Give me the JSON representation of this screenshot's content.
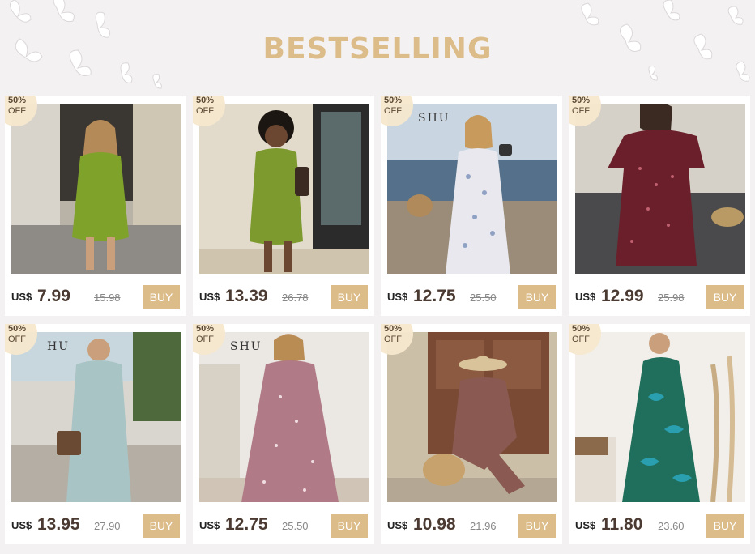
{
  "heading": "BESTSELLING",
  "colors": {
    "accent": "#dcbc88",
    "background": "#f3f1f2",
    "card": "#ffffff",
    "badge": "#f6e8ce"
  },
  "products": [
    {
      "discount_pct": "50%",
      "discount_off": "OFF",
      "currency": "US$",
      "price": "7.99",
      "old_price": "15.98",
      "buy_label": "BUY",
      "image": "green-ruched-mini-dress-photo",
      "overlay_text": ""
    },
    {
      "discount_pct": "50%",
      "discount_off": "OFF",
      "currency": "US$",
      "price": "13.39",
      "old_price": "26.78",
      "buy_label": "BUY",
      "image": "green-button-mini-dress-photo",
      "overlay_text": ""
    },
    {
      "discount_pct": "50%",
      "discount_off": "OFF",
      "currency": "US$",
      "price": "12.75",
      "old_price": "25.50",
      "buy_label": "BUY",
      "image": "white-floral-midi-dress-photo",
      "overlay_text": "SHU"
    },
    {
      "discount_pct": "50%",
      "discount_off": "OFF",
      "currency": "US$",
      "price": "12.99",
      "old_price": "25.98",
      "buy_label": "BUY",
      "image": "burgundy-puff-sleeve-dress-photo",
      "overlay_text": ""
    },
    {
      "discount_pct": "50%",
      "discount_off": "OFF",
      "currency": "US$",
      "price": "13.95",
      "old_price": "27.90",
      "buy_label": "BUY",
      "image": "light-blue-shirt-dress-photo",
      "overlay_text": "HU"
    },
    {
      "discount_pct": "50%",
      "discount_off": "OFF",
      "currency": "US$",
      "price": "12.75",
      "old_price": "25.50",
      "buy_label": "BUY",
      "image": "pink-floral-maxi-dress-photo",
      "overlay_text": "SHU"
    },
    {
      "discount_pct": "50%",
      "discount_off": "OFF",
      "currency": "US$",
      "price": "10.98",
      "old_price": "21.96",
      "buy_label": "BUY",
      "image": "floral-wrap-dress-with-hat-photo",
      "overlay_text": ""
    },
    {
      "discount_pct": "50%",
      "discount_off": "OFF",
      "currency": "US$",
      "price": "11.80",
      "old_price": "23.60",
      "buy_label": "BUY",
      "image": "tropical-print-maxi-dress-photo",
      "overlay_text": ""
    }
  ]
}
